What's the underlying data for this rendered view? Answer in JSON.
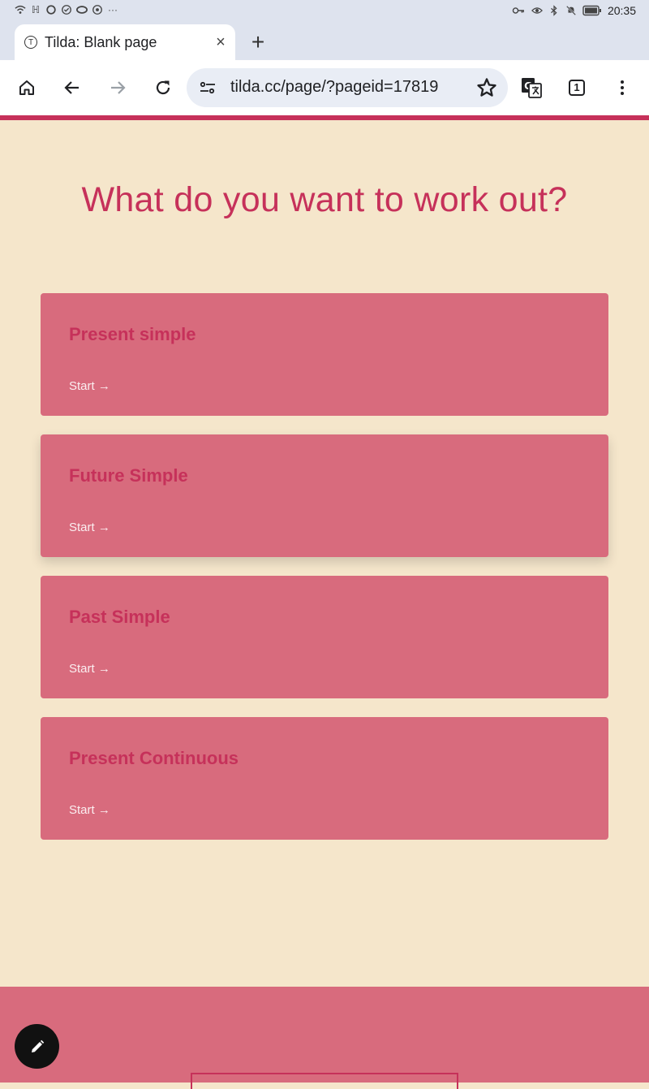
{
  "status_bar": {
    "time": "20:35",
    "notification_more": "···"
  },
  "browser": {
    "tab": {
      "favicon_letter": "T",
      "title": "Tilda: Blank page",
      "close": "×"
    },
    "new_tab": "+",
    "omnibox": {
      "url": "tilda.cc/page/?pageid=17819"
    },
    "tab_count": "1"
  },
  "page": {
    "heading": "What do you want to work out?",
    "cards": [
      {
        "title": "Present simple",
        "action": "Start →"
      },
      {
        "title": "Future Simple",
        "action": "Start →"
      },
      {
        "title": "Past Simple",
        "action": "Start →"
      },
      {
        "title": "Present Continuous",
        "action": "Start →"
      }
    ]
  },
  "colors": {
    "background": "#f5e6cb",
    "accent": "#c6315a",
    "card": "#d86b7d",
    "card_text": "#fbeef0"
  },
  "icons": [
    "home-icon",
    "back-icon",
    "forward-icon",
    "reload-icon",
    "site-settings-icon",
    "star-icon",
    "translate-icon",
    "tab-switcher-icon",
    "menu-icon",
    "edit-icon"
  ]
}
